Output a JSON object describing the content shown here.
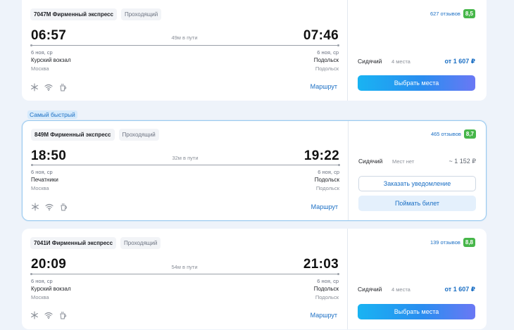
{
  "cards": [
    {
      "train": "7047М Фирменный экспресс",
      "type": "Проходящий",
      "dep_time": "06:57",
      "arr_time": "07:46",
      "duration": "49м в пути",
      "dep_date": "6 ноя, ср",
      "arr_date": "6 ноя, ср",
      "dep_station": "Курский вокзал",
      "arr_station": "Подольск",
      "dep_city": "Москва",
      "arr_city": "Подольск",
      "route_link": "Маршрут",
      "reviews": "627 отзывов",
      "rating": "8,5",
      "seat_type": "Сидячий",
      "seats": "4 места",
      "price": "от 1 607 ₽",
      "button": "Выбрать места"
    },
    {
      "badge": "Самый быстрый",
      "train": "849М Фирменный экспресс",
      "type": "Проходящий",
      "dep_time": "18:50",
      "arr_time": "19:22",
      "duration": "32м в пути",
      "dep_date": "6 ноя, ср",
      "arr_date": "6 ноя, ср",
      "dep_station": "Печатники",
      "arr_station": "Подольск",
      "dep_city": "Москва",
      "arr_city": "Подольск",
      "route_link": "Маршрут",
      "reviews": "465 отзывов",
      "rating": "8,7",
      "seat_type": "Сидячий",
      "seats": "Мест нет",
      "price": "~ 1 152 ₽",
      "button_notify": "Заказать уведомление",
      "button_catch": "Поймать билет"
    },
    {
      "train": "7041И Фирменный экспресс",
      "type": "Проходящий",
      "dep_time": "20:09",
      "arr_time": "21:03",
      "duration": "54м в пути",
      "dep_date": "6 ноя, ср",
      "arr_date": "6 ноя, ср",
      "dep_station": "Курский вокзал",
      "arr_station": "Подольск",
      "dep_city": "Москва",
      "arr_city": "Подольск",
      "route_link": "Маршрут",
      "reviews": "139 отзывов",
      "rating": "8,8",
      "seat_type": "Сидячий",
      "seats": "4 места",
      "price": "от 1 607 ₽",
      "button": "Выбрать места"
    }
  ],
  "colors": {
    "accent": "#1b6fc4",
    "rating_bg": "#46b649",
    "page_bg": "#eef3fa"
  },
  "amenity_icons": [
    "snowflake-icon",
    "wifi-icon",
    "coffee-icon"
  ]
}
